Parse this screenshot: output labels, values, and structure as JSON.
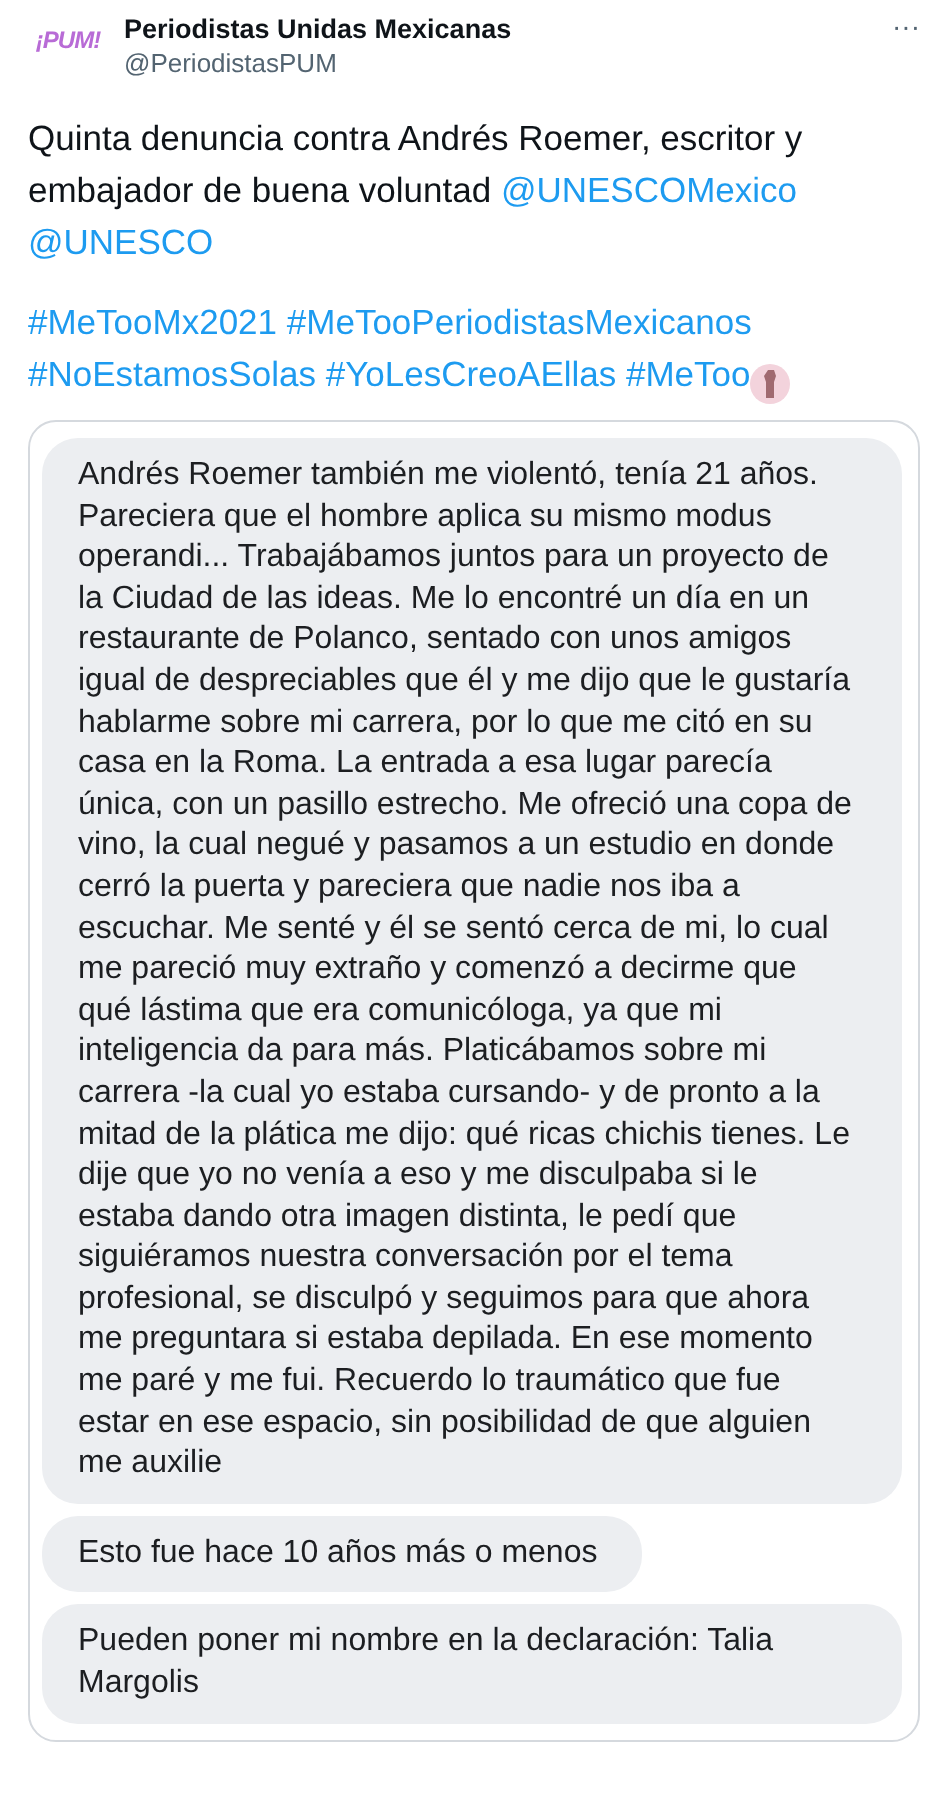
{
  "account": {
    "avatar_text": "¡PUM!",
    "name": "Periodistas Unidas Mexicanas",
    "handle": "@PeriodistasPUM",
    "more": "···"
  },
  "tweet": {
    "paragraphs": [
      [
        {
          "kind": "text",
          "text": "Quinta denuncia contra Andrés Roemer, escritor y embajador de buena voluntad "
        },
        {
          "kind": "mention",
          "text": "@UNESCOMexico"
        },
        {
          "kind": "space"
        },
        {
          "kind": "mention",
          "text": "@UNESCO"
        }
      ],
      [
        {
          "kind": "hashtag",
          "text": "#MeTooMx2021"
        },
        {
          "kind": "space"
        },
        {
          "kind": "hashtag",
          "text": "#MeTooPeriodistasMexicanos"
        },
        {
          "kind": "space"
        },
        {
          "kind": "hashtag",
          "text": "#NoEstamosSolas"
        },
        {
          "kind": "space"
        },
        {
          "kind": "hashtag",
          "text": "#YoLesCreoAEllas"
        },
        {
          "kind": "space"
        },
        {
          "kind": "hashtag",
          "text": "#MeToo"
        },
        {
          "kind": "emoji"
        }
      ]
    ]
  },
  "messages": [
    {
      "text": "Andrés Roemer también me violentó, tenía 21 años. Pareciera que el hombre aplica su mismo modus operandi... Trabajábamos juntos para un proyecto de la Ciudad de las ideas. Me lo encontré un día en un restaurante de Polanco, sentado con unos amigos igual de despreciables que él y me dijo que le gustaría hablarme sobre mi carrera, por lo que me citó en su casa en la Roma. La entrada a esa lugar parecía única, con un pasillo estrecho. Me ofreció una copa de vino, la cual negué y pasamos a un estudio en donde cerró la puerta y pareciera que nadie nos iba a escuchar. Me senté y él se sentó cerca de mi, lo cual me pareció muy extraño y comenzó a decirme que qué lástima que era comunicóloga, ya que mi inteligencia da para más. Platicábamos sobre mi carrera -la cual yo estaba cursando- y de pronto a la mitad de la plática me dijo: qué ricas chichis tienes. Le dije que yo no venía a eso y me disculpaba si le estaba dando otra imagen distinta, le pedí que siguiéramos nuestra conversación por el tema profesional, se disculpó y seguimos para que ahora me preguntara si estaba depilada. En ese momento me paré y me fui. Recuerdo lo traumático que fue estar en ese espacio, sin posibilidad de que alguien me auxilie"
    },
    {
      "text": "Esto fue hace 10 años más o menos"
    },
    {
      "text": "Pueden poner mi nombre en la declaración: Talia Margolis"
    }
  ]
}
